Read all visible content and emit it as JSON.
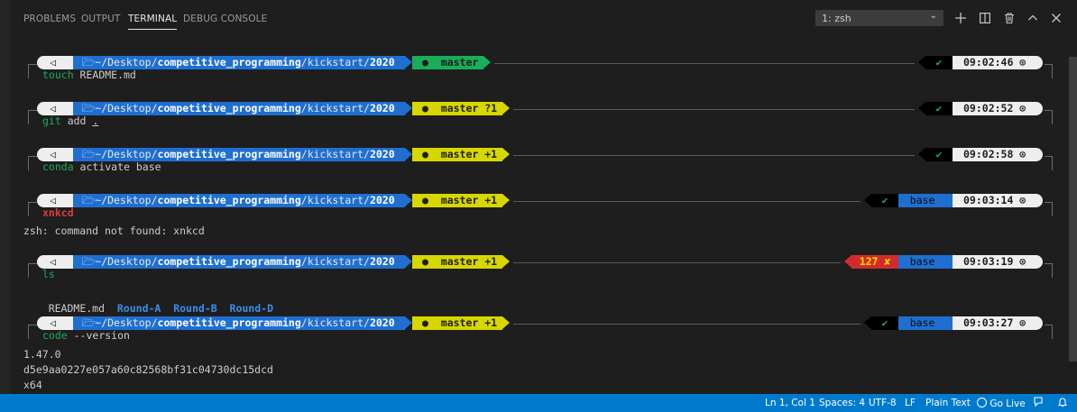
{
  "panel": {
    "tabs": [
      "PROBLEMS",
      "OUTPUT",
      "TERMINAL",
      "DEBUG CONSOLE"
    ],
    "active_tab": "TERMINAL",
    "terminal_select": "1: zsh",
    "icons": [
      "plus-icon",
      "split-icon",
      "trash-icon",
      "chevron-up-icon",
      "close-icon"
    ]
  },
  "colors": {
    "accent": "#007acc",
    "path_bg": "#1f6fd1",
    "git_clean": "#1aad5a",
    "git_dirty": "#d7d700",
    "error": "#d32b2b"
  },
  "prompt": {
    "os_icon": "",
    "path_prefix": "~/Desktop/",
    "path_dir1": "competitive_programming",
    "path_sep": "/kickstart/",
    "path_dir2": "2020"
  },
  "rows": [
    {
      "git": " master",
      "status": "✔",
      "env": "",
      "time": "09:02:46 ⊙",
      "cmd": "touch",
      "args": " README.md"
    },
    {
      "git": " master ?1",
      "status": "✔",
      "env": "",
      "time": "09:02:52 ⊙",
      "cmd": "git",
      "args": " add ",
      "args_u": "."
    },
    {
      "git": " master +1",
      "status": "✔",
      "env": "",
      "time": "09:02:58 ⊙",
      "cmd": "conda",
      "args": " activate base"
    },
    {
      "git": " master +1",
      "status": "✔",
      "env": "base ",
      "time": "09:03:14 ⊙",
      "cmd": "xnkcd",
      "args": ""
    },
    {
      "git": " master +1",
      "status": "127 ✘",
      "env": "base ",
      "time": "09:03:19 ⊙",
      "cmd": "ls",
      "args": ""
    },
    {
      "git": " master +1",
      "status": "✔",
      "env": "base ",
      "time": "09:03:27 ⊙",
      "cmd": "code",
      "args": " --version"
    }
  ],
  "outputs": {
    "error": "zsh: command not found: xnkcd",
    "ls_file": "README.md",
    "ls_dirs": [
      "Round-A",
      "Round-B",
      "Round-D"
    ],
    "version": [
      "1.47.0",
      "d5e9aa0227e057a60c82568bf31c04730dc15dcd",
      "x64"
    ]
  },
  "statusbar": {
    "position": "Ln 1, Col 1",
    "spaces": "Spaces: 4",
    "encoding": "UTF-8",
    "eol": "LF",
    "language": "Plain Text",
    "golive": "Go Live"
  }
}
